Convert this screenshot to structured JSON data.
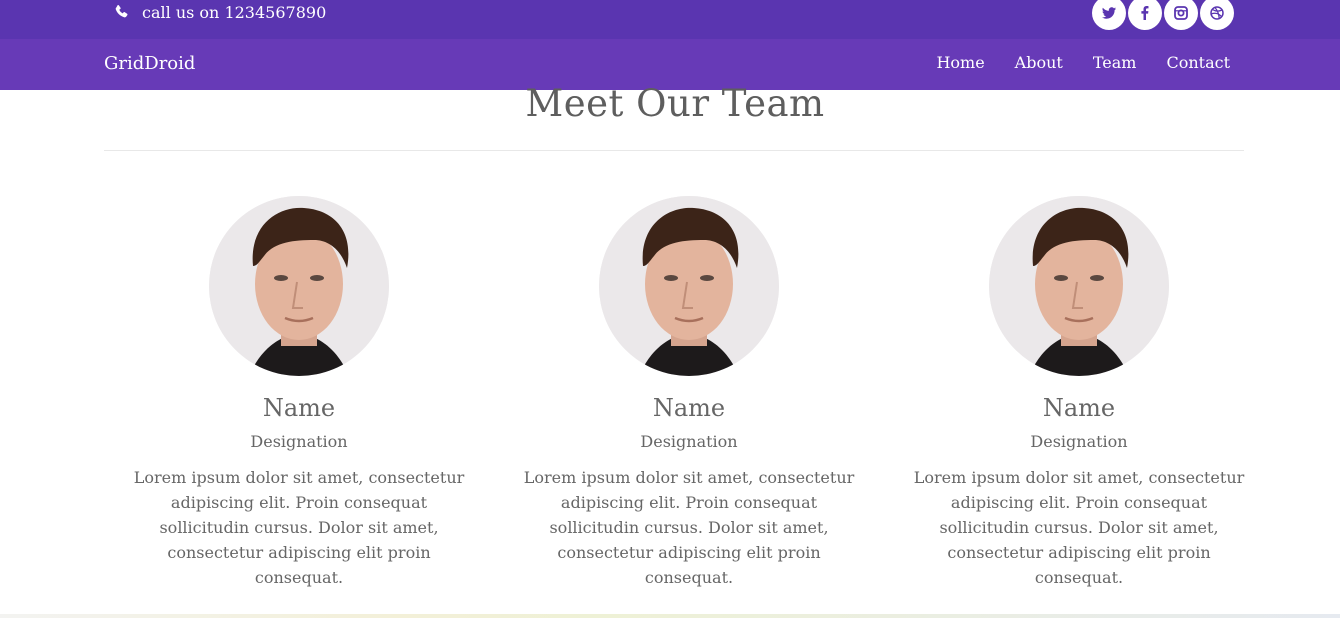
{
  "topbar": {
    "phone_text": "call us on 1234567890",
    "social": [
      "twitter-icon",
      "facebook-icon",
      "instagram-icon",
      "dribbble-icon"
    ]
  },
  "nav": {
    "brand": "GridDroid",
    "links": [
      "Home",
      "About",
      "Team",
      "Contact"
    ]
  },
  "section": {
    "title": "Meet Our Team"
  },
  "team": [
    {
      "name": "Name",
      "designation": "Designation",
      "bio": "Lorem ipsum dolor sit amet, consectetur adipiscing elit. Proin consequat sollicitudin cursus. Dolor sit amet, consectetur adipiscing elit proin consequat."
    },
    {
      "name": "Name",
      "designation": "Designation",
      "bio": "Lorem ipsum dolor sit amet, consectetur adipiscing elit. Proin consequat sollicitudin cursus. Dolor sit amet, consectetur adipiscing elit proin consequat."
    },
    {
      "name": "Name",
      "designation": "Designation",
      "bio": "Lorem ipsum dolor sit amet, consectetur adipiscing elit. Proin consequat sollicitudin cursus. Dolor sit amet, consectetur adipiscing elit proin consequat."
    }
  ],
  "colors": {
    "topbar": "#5a35b0",
    "navbar": "#673ab7",
    "text": "#666666"
  }
}
